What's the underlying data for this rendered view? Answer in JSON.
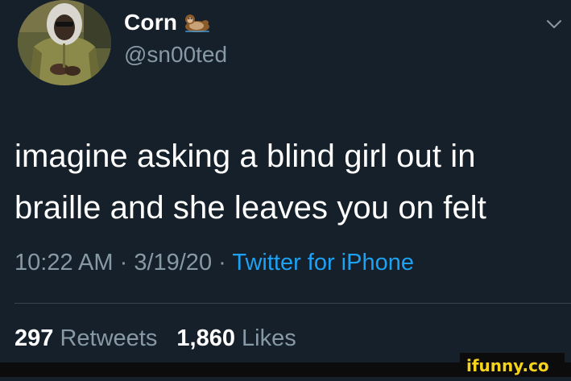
{
  "user": {
    "display_name": "Corn",
    "handle": "@sn00ted",
    "name_emoji_icon": "otter-icon"
  },
  "tweet": {
    "text_line1": "imagine asking a blind girl out in",
    "text_line2": "braille and she leaves you on felt"
  },
  "meta": {
    "time": "10:22 AM",
    "separator": " · ",
    "date": "3/19/20",
    "source": "Twitter for iPhone"
  },
  "stats": {
    "retweets_count": "297",
    "retweets_label": "Retweets",
    "likes_count": "1,860",
    "likes_label": "Likes"
  },
  "watermark": {
    "text": "ifunny.co"
  },
  "colors": {
    "background": "#15202b",
    "secondary_text": "#8899a6",
    "link": "#1da1f2",
    "watermark": "#f6d31b"
  }
}
